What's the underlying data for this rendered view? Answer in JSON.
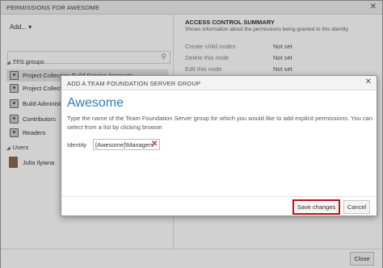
{
  "window": {
    "title": "PERMISSIONS FOR AWESOME",
    "close_label": "Close",
    "close_glyph": "✕"
  },
  "left_panel": {
    "add_label": "Add...",
    "search_placeholder": "",
    "groups_header": "TFS groups",
    "groups": [
      {
        "label": "Project Collection Build Service Accounts",
        "selected": true
      },
      {
        "label": "Project Collection Administrators",
        "selected": false
      },
      {
        "label": "Build Administrators",
        "selected": false
      },
      {
        "label": "Contributors",
        "selected": false
      },
      {
        "label": "Readers",
        "selected": false
      }
    ],
    "users_header": "Users",
    "users": [
      {
        "label": "Julia Ilyiana"
      }
    ]
  },
  "right_panel": {
    "title": "ACCESS CONTROL SUMMARY",
    "subtitle": "Shows information about the permissions being granted to this identity",
    "permissions": [
      {
        "name": "Create child nodes",
        "value": "Not set"
      },
      {
        "name": "Delete this node",
        "value": "Not set"
      },
      {
        "name": "Edit this node",
        "value": "Not set"
      }
    ]
  },
  "dialog": {
    "title": "ADD A TEAM FOUNDATION SERVER GROUP",
    "close_glyph": "✕",
    "heading": "Awesome",
    "description": "Type the name of the Team Foundation Server group for which you would like to add explicit permissions. You can select from a list by clicking browse.",
    "identity_label": "Identity",
    "identity_value": "[Awesome]\\Managers",
    "remove_glyph": "✕",
    "save_label": "Save changes",
    "cancel_label": "Cancel"
  },
  "colors": {
    "accent": "#2a7dc2",
    "highlight_border": "#b5121b",
    "remove_icon": "#c0392b"
  }
}
